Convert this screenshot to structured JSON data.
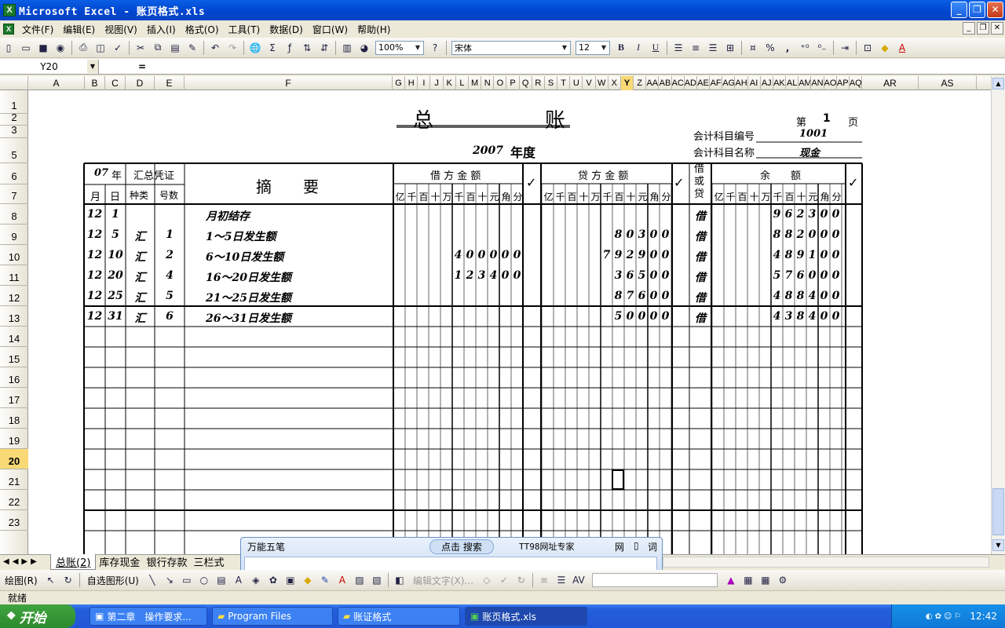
{
  "window": {
    "title": "Microsoft Excel - 账页格式.xls",
    "min": "_",
    "max": "❐",
    "close": "✕"
  },
  "menu": [
    "文件(F)",
    "编辑(E)",
    "视图(V)",
    "插入(I)",
    "格式(O)",
    "工具(T)",
    "数据(D)",
    "窗口(W)",
    "帮助(H)"
  ],
  "toolbar": {
    "zoom": "100%",
    "font": "宋体",
    "size": "12",
    "bold": "B",
    "italic": "I",
    "underline": "U",
    "percent": "%",
    "comma": ","
  },
  "formula": {
    "namebox": "Y20",
    "eq": "="
  },
  "columns": [
    "A",
    "B",
    "C",
    "D",
    "E",
    "F",
    "G",
    "H",
    "I",
    "J",
    "K",
    "L",
    "M",
    "N",
    "O",
    "P",
    "Q",
    "R",
    "S",
    "T",
    "U",
    "V",
    "W",
    "X",
    "Y",
    "Z",
    "AA",
    "AB",
    "AC",
    "AD",
    "AE",
    "AF",
    "AG",
    "AH",
    "AI",
    "AJ",
    "AK",
    "AL",
    "AM",
    "AN",
    "AO",
    "AP",
    "AQ",
    "AR",
    "AS"
  ],
  "rows": [
    "1",
    "2",
    "3",
    "5",
    "6",
    "7",
    "8",
    "9",
    "10",
    "11",
    "12",
    "13",
    "14",
    "15",
    "16",
    "17",
    "18",
    "19",
    "20",
    "21",
    "22",
    "23"
  ],
  "ledger": {
    "title": "总　　　　　账",
    "page_label": "第",
    "page_no": "1",
    "page_unit": "页",
    "code_label": "会计科目编号",
    "code_value": "1001",
    "year_value": "2007",
    "year_label": "年度",
    "name_label": "会计科目名称",
    "name_value": "现金",
    "h_year": "07",
    "h_year_unit": "年",
    "h_voucher": "汇总凭证",
    "h_month": "月",
    "h_day": "日",
    "h_kind": "种类",
    "h_num": "号数",
    "h_summary": "摘　　要",
    "h_debit": "借 方 金 额",
    "h_credit": "贷 方 金 额",
    "h_dc": "借或贷",
    "h_balance": "余　　额",
    "check": "✓",
    "units": [
      "亿",
      "千",
      "百",
      "十",
      "万",
      "千",
      "百",
      "十",
      "元",
      "角",
      "分"
    ],
    "entries": [
      {
        "m": "12",
        "d": "1",
        "kind": "",
        "no": "",
        "summary": "月初结存",
        "debit": "",
        "credit": "",
        "dc": "借",
        "balance": "962300"
      },
      {
        "m": "12",
        "d": "5",
        "kind": "汇",
        "no": "1",
        "summary": "1～5日发生额",
        "debit": "",
        "credit": "80300",
        "dc": "借",
        "balance": "882000"
      },
      {
        "m": "12",
        "d": "10",
        "kind": "汇",
        "no": "2",
        "summary": "6～10日发生额",
        "debit": "400000",
        "credit": "792900",
        "dc": "借",
        "balance": "489100"
      },
      {
        "m": "12",
        "d": "20",
        "kind": "汇",
        "no": "4",
        "summary": "16～20日发生额",
        "debit": "123400",
        "credit": "36500",
        "dc": "借",
        "balance": "576000"
      },
      {
        "m": "12",
        "d": "25",
        "kind": "汇",
        "no": "5",
        "summary": "21～25日发生额",
        "debit": "",
        "credit": "87600",
        "dc": "借",
        "balance": "488400"
      },
      {
        "m": "12",
        "d": "31",
        "kind": "汇",
        "no": "6",
        "summary": "26～31日发生额",
        "debit": "",
        "credit": "50000",
        "dc": "借",
        "balance": "438400"
      }
    ]
  },
  "sheets": [
    "总账(2)",
    "库存现金",
    "银行存款",
    "三栏式"
  ],
  "drawbar": {
    "draw": "绘图(R)",
    "autoshape": "自选图形(U)",
    "edittext": "编辑文字(X)..."
  },
  "status": "就绪",
  "ime": {
    "name": "万能五笔",
    "search": "点击 搜索",
    "expert": "TT98网址专家",
    "net": "网",
    "ci": "词"
  },
  "taskbar": {
    "start": "开始",
    "tasks": [
      "第二章　操作要求...",
      "Program Files",
      "账证格式",
      "账页格式.xls"
    ],
    "clock": "12:42"
  }
}
